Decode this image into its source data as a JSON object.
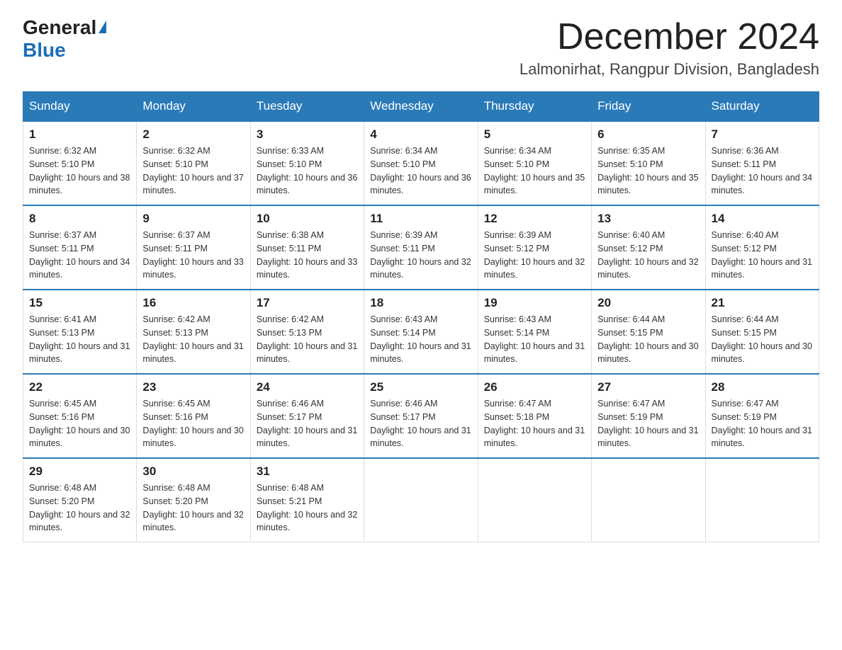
{
  "logo": {
    "general": "General",
    "blue": "Blue",
    "triangle_unicode": "▲"
  },
  "header": {
    "month_title": "December 2024",
    "subtitle": "Lalmonirhat, Rangpur Division, Bangladesh"
  },
  "weekdays": [
    "Sunday",
    "Monday",
    "Tuesday",
    "Wednesday",
    "Thursday",
    "Friday",
    "Saturday"
  ],
  "weeks": [
    [
      {
        "day": "1",
        "sunrise": "Sunrise: 6:32 AM",
        "sunset": "Sunset: 5:10 PM",
        "daylight": "Daylight: 10 hours and 38 minutes."
      },
      {
        "day": "2",
        "sunrise": "Sunrise: 6:32 AM",
        "sunset": "Sunset: 5:10 PM",
        "daylight": "Daylight: 10 hours and 37 minutes."
      },
      {
        "day": "3",
        "sunrise": "Sunrise: 6:33 AM",
        "sunset": "Sunset: 5:10 PM",
        "daylight": "Daylight: 10 hours and 36 minutes."
      },
      {
        "day": "4",
        "sunrise": "Sunrise: 6:34 AM",
        "sunset": "Sunset: 5:10 PM",
        "daylight": "Daylight: 10 hours and 36 minutes."
      },
      {
        "day": "5",
        "sunrise": "Sunrise: 6:34 AM",
        "sunset": "Sunset: 5:10 PM",
        "daylight": "Daylight: 10 hours and 35 minutes."
      },
      {
        "day": "6",
        "sunrise": "Sunrise: 6:35 AM",
        "sunset": "Sunset: 5:10 PM",
        "daylight": "Daylight: 10 hours and 35 minutes."
      },
      {
        "day": "7",
        "sunrise": "Sunrise: 6:36 AM",
        "sunset": "Sunset: 5:11 PM",
        "daylight": "Daylight: 10 hours and 34 minutes."
      }
    ],
    [
      {
        "day": "8",
        "sunrise": "Sunrise: 6:37 AM",
        "sunset": "Sunset: 5:11 PM",
        "daylight": "Daylight: 10 hours and 34 minutes."
      },
      {
        "day": "9",
        "sunrise": "Sunrise: 6:37 AM",
        "sunset": "Sunset: 5:11 PM",
        "daylight": "Daylight: 10 hours and 33 minutes."
      },
      {
        "day": "10",
        "sunrise": "Sunrise: 6:38 AM",
        "sunset": "Sunset: 5:11 PM",
        "daylight": "Daylight: 10 hours and 33 minutes."
      },
      {
        "day": "11",
        "sunrise": "Sunrise: 6:39 AM",
        "sunset": "Sunset: 5:11 PM",
        "daylight": "Daylight: 10 hours and 32 minutes."
      },
      {
        "day": "12",
        "sunrise": "Sunrise: 6:39 AM",
        "sunset": "Sunset: 5:12 PM",
        "daylight": "Daylight: 10 hours and 32 minutes."
      },
      {
        "day": "13",
        "sunrise": "Sunrise: 6:40 AM",
        "sunset": "Sunset: 5:12 PM",
        "daylight": "Daylight: 10 hours and 32 minutes."
      },
      {
        "day": "14",
        "sunrise": "Sunrise: 6:40 AM",
        "sunset": "Sunset: 5:12 PM",
        "daylight": "Daylight: 10 hours and 31 minutes."
      }
    ],
    [
      {
        "day": "15",
        "sunrise": "Sunrise: 6:41 AM",
        "sunset": "Sunset: 5:13 PM",
        "daylight": "Daylight: 10 hours and 31 minutes."
      },
      {
        "day": "16",
        "sunrise": "Sunrise: 6:42 AM",
        "sunset": "Sunset: 5:13 PM",
        "daylight": "Daylight: 10 hours and 31 minutes."
      },
      {
        "day": "17",
        "sunrise": "Sunrise: 6:42 AM",
        "sunset": "Sunset: 5:13 PM",
        "daylight": "Daylight: 10 hours and 31 minutes."
      },
      {
        "day": "18",
        "sunrise": "Sunrise: 6:43 AM",
        "sunset": "Sunset: 5:14 PM",
        "daylight": "Daylight: 10 hours and 31 minutes."
      },
      {
        "day": "19",
        "sunrise": "Sunrise: 6:43 AM",
        "sunset": "Sunset: 5:14 PM",
        "daylight": "Daylight: 10 hours and 31 minutes."
      },
      {
        "day": "20",
        "sunrise": "Sunrise: 6:44 AM",
        "sunset": "Sunset: 5:15 PM",
        "daylight": "Daylight: 10 hours and 30 minutes."
      },
      {
        "day": "21",
        "sunrise": "Sunrise: 6:44 AM",
        "sunset": "Sunset: 5:15 PM",
        "daylight": "Daylight: 10 hours and 30 minutes."
      }
    ],
    [
      {
        "day": "22",
        "sunrise": "Sunrise: 6:45 AM",
        "sunset": "Sunset: 5:16 PM",
        "daylight": "Daylight: 10 hours and 30 minutes."
      },
      {
        "day": "23",
        "sunrise": "Sunrise: 6:45 AM",
        "sunset": "Sunset: 5:16 PM",
        "daylight": "Daylight: 10 hours and 30 minutes."
      },
      {
        "day": "24",
        "sunrise": "Sunrise: 6:46 AM",
        "sunset": "Sunset: 5:17 PM",
        "daylight": "Daylight: 10 hours and 31 minutes."
      },
      {
        "day": "25",
        "sunrise": "Sunrise: 6:46 AM",
        "sunset": "Sunset: 5:17 PM",
        "daylight": "Daylight: 10 hours and 31 minutes."
      },
      {
        "day": "26",
        "sunrise": "Sunrise: 6:47 AM",
        "sunset": "Sunset: 5:18 PM",
        "daylight": "Daylight: 10 hours and 31 minutes."
      },
      {
        "day": "27",
        "sunrise": "Sunrise: 6:47 AM",
        "sunset": "Sunset: 5:19 PM",
        "daylight": "Daylight: 10 hours and 31 minutes."
      },
      {
        "day": "28",
        "sunrise": "Sunrise: 6:47 AM",
        "sunset": "Sunset: 5:19 PM",
        "daylight": "Daylight: 10 hours and 31 minutes."
      }
    ],
    [
      {
        "day": "29",
        "sunrise": "Sunrise: 6:48 AM",
        "sunset": "Sunset: 5:20 PM",
        "daylight": "Daylight: 10 hours and 32 minutes."
      },
      {
        "day": "30",
        "sunrise": "Sunrise: 6:48 AM",
        "sunset": "Sunset: 5:20 PM",
        "daylight": "Daylight: 10 hours and 32 minutes."
      },
      {
        "day": "31",
        "sunrise": "Sunrise: 6:48 AM",
        "sunset": "Sunset: 5:21 PM",
        "daylight": "Daylight: 10 hours and 32 minutes."
      },
      null,
      null,
      null,
      null
    ]
  ]
}
